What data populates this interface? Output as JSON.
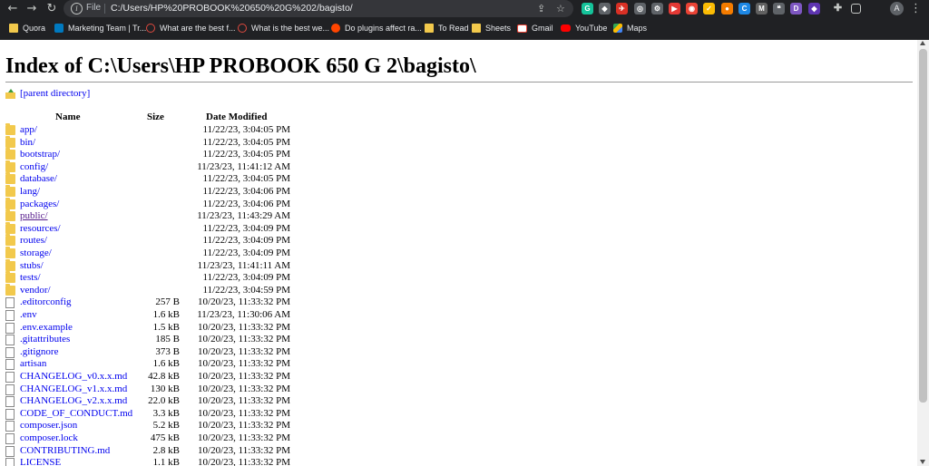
{
  "browser": {
    "scheme_label": "File",
    "url": "C:/Users/HP%20PROBOOK%20650%20G%202/bagisto/",
    "profile_initial": "A",
    "extensions": [
      {
        "name": "grammarly-extension-icon",
        "glyph": "G",
        "color": "#15c39a"
      },
      {
        "name": "extension-icon-2",
        "glyph": "◆",
        "color": "#5f6368"
      },
      {
        "name": "extension-icon-3",
        "glyph": "✈",
        "color": "#d93025"
      },
      {
        "name": "extension-icon-4",
        "glyph": "◎",
        "color": "#5f6368"
      },
      {
        "name": "extension-icon-5",
        "glyph": "⚙",
        "color": "#5f6368"
      },
      {
        "name": "extension-icon-6",
        "glyph": "▶",
        "color": "#e53935"
      },
      {
        "name": "extension-icon-7",
        "glyph": "◉",
        "color": "#ea4335"
      },
      {
        "name": "extension-icon-8",
        "glyph": "✓",
        "color": "#fbbc04"
      },
      {
        "name": "extension-icon-9",
        "glyph": "●",
        "color": "#f57c00"
      },
      {
        "name": "extension-icon-10",
        "glyph": "C",
        "color": "#1e88e5"
      },
      {
        "name": "extension-icon-11",
        "glyph": "M",
        "color": "#616161"
      },
      {
        "name": "extension-icon-12",
        "glyph": "❝",
        "color": "#5f6368"
      },
      {
        "name": "extension-icon-13",
        "glyph": "D",
        "color": "#7e57c2"
      },
      {
        "name": "extension-icon-14",
        "glyph": "◆",
        "color": "#5e35b1"
      }
    ]
  },
  "bookmarks": [
    {
      "label": "Quora",
      "icon": "folder"
    },
    {
      "label": "Marketing Team | Tr...",
      "icon": "trello"
    },
    {
      "label": "What are the best f...",
      "icon": "quora"
    },
    {
      "label": "What is the best we...",
      "icon": "quora"
    },
    {
      "label": "Do plugins affect ra...",
      "icon": "reddit"
    },
    {
      "label": "To Read",
      "icon": "folder"
    },
    {
      "label": "Sheets",
      "icon": "folder"
    },
    {
      "label": "Gmail",
      "icon": "gmail"
    },
    {
      "label": "YouTube",
      "icon": "yt"
    },
    {
      "label": "Maps",
      "icon": "maps"
    }
  ],
  "page": {
    "title": "Index of C:\\Users\\HP PROBOOK 650 G 2\\bagisto\\",
    "parent_label": "[parent directory]",
    "headers": {
      "name": "Name",
      "size": "Size",
      "date": "Date Modified"
    },
    "rows": [
      {
        "name": "app/",
        "size": "",
        "date": "11/22/23, 3:04:05 PM",
        "type": "folder"
      },
      {
        "name": "bin/",
        "size": "",
        "date": "11/22/23, 3:04:05 PM",
        "type": "folder"
      },
      {
        "name": "bootstrap/",
        "size": "",
        "date": "11/22/23, 3:04:05 PM",
        "type": "folder"
      },
      {
        "name": "config/",
        "size": "",
        "date": "11/23/23, 11:41:12 AM",
        "type": "folder"
      },
      {
        "name": "database/",
        "size": "",
        "date": "11/22/23, 3:04:05 PM",
        "type": "folder"
      },
      {
        "name": "lang/",
        "size": "",
        "date": "11/22/23, 3:04:06 PM",
        "type": "folder"
      },
      {
        "name": "packages/",
        "size": "",
        "date": "11/22/23, 3:04:06 PM",
        "type": "folder"
      },
      {
        "name": "public/",
        "size": "",
        "date": "11/23/23, 11:43:29 AM",
        "type": "folder",
        "visited": true
      },
      {
        "name": "resources/",
        "size": "",
        "date": "11/22/23, 3:04:09 PM",
        "type": "folder"
      },
      {
        "name": "routes/",
        "size": "",
        "date": "11/22/23, 3:04:09 PM",
        "type": "folder"
      },
      {
        "name": "storage/",
        "size": "",
        "date": "11/22/23, 3:04:09 PM",
        "type": "folder"
      },
      {
        "name": "stubs/",
        "size": "",
        "date": "11/23/23, 11:41:11 AM",
        "type": "folder"
      },
      {
        "name": "tests/",
        "size": "",
        "date": "11/22/23, 3:04:09 PM",
        "type": "folder"
      },
      {
        "name": "vendor/",
        "size": "",
        "date": "11/22/23, 3:04:59 PM",
        "type": "folder"
      },
      {
        "name": ".editorconfig",
        "size": "257 B",
        "date": "10/20/23, 11:33:32 PM",
        "type": "file"
      },
      {
        "name": ".env",
        "size": "1.6 kB",
        "date": "11/23/23, 11:30:06 AM",
        "type": "file"
      },
      {
        "name": ".env.example",
        "size": "1.5 kB",
        "date": "10/20/23, 11:33:32 PM",
        "type": "file"
      },
      {
        "name": ".gitattributes",
        "size": "185 B",
        "date": "10/20/23, 11:33:32 PM",
        "type": "file"
      },
      {
        "name": ".gitignore",
        "size": "373 B",
        "date": "10/20/23, 11:33:32 PM",
        "type": "file"
      },
      {
        "name": "artisan",
        "size": "1.6 kB",
        "date": "10/20/23, 11:33:32 PM",
        "type": "file"
      },
      {
        "name": "CHANGELOG_v0.x.x.md",
        "size": "42.8 kB",
        "date": "10/20/23, 11:33:32 PM",
        "type": "file"
      },
      {
        "name": "CHANGELOG_v1.x.x.md",
        "size": "130 kB",
        "date": "10/20/23, 11:33:32 PM",
        "type": "file"
      },
      {
        "name": "CHANGELOG_v2.x.x.md",
        "size": "22.0 kB",
        "date": "10/20/23, 11:33:32 PM",
        "type": "file"
      },
      {
        "name": "CODE_OF_CONDUCT.md",
        "size": "3.3 kB",
        "date": "10/20/23, 11:33:32 PM",
        "type": "file"
      },
      {
        "name": "composer.json",
        "size": "5.2 kB",
        "date": "10/20/23, 11:33:32 PM",
        "type": "file"
      },
      {
        "name": "composer.lock",
        "size": "475 kB",
        "date": "10/20/23, 11:33:32 PM",
        "type": "file"
      },
      {
        "name": "CONTRIBUTING.md",
        "size": "2.8 kB",
        "date": "10/20/23, 11:33:32 PM",
        "type": "file"
      },
      {
        "name": "LICENSE",
        "size": "1.1 kB",
        "date": "10/20/23, 11:33:32 PM",
        "type": "file"
      }
    ]
  }
}
